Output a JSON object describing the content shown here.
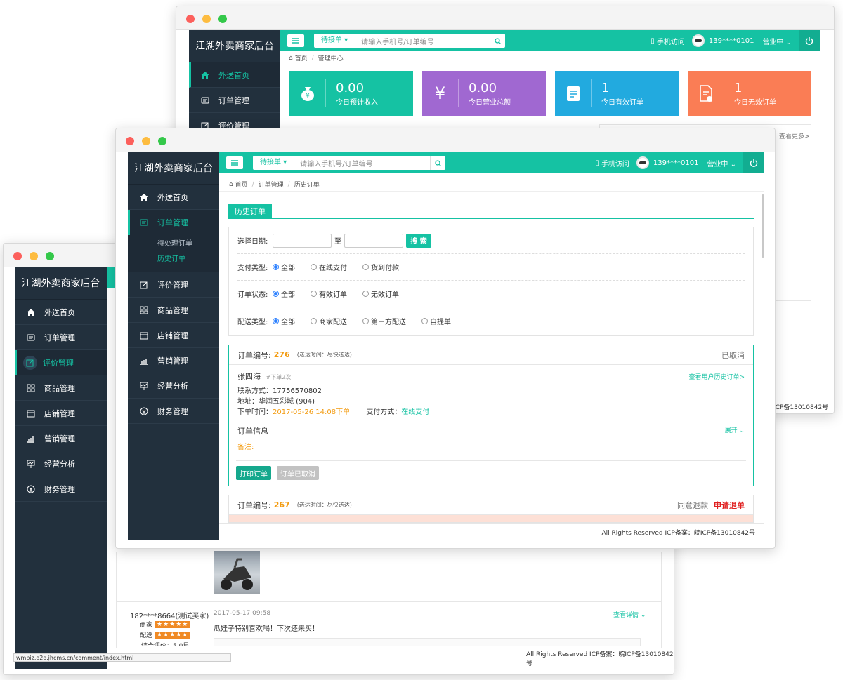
{
  "back": {
    "brand": "江湖外卖商家后台",
    "nav": [
      {
        "label": "外送首页",
        "icon": "home-icon",
        "active": true
      },
      {
        "label": "订单管理",
        "icon": "order-icon"
      },
      {
        "label": "评价管理",
        "icon": "edit-icon"
      }
    ],
    "search": {
      "select": "待接单",
      "placeholder": "请输入手机号/订单编号"
    },
    "mobile": "手机访问",
    "phone": "139****0101",
    "status": "营业中",
    "breadcrumb": [
      "首页",
      "管理中心"
    ],
    "cards": [
      {
        "value": "0.00",
        "label": "今日预计收入",
        "color": "#15c2a3",
        "icon": "money-bag-icon"
      },
      {
        "value": "0.00",
        "label": "今日营业总额",
        "color": "#a068d1",
        "icon": "yen-icon"
      },
      {
        "value": "1",
        "label": "今日有效订单",
        "color": "#22aadf",
        "icon": "clipboard-check-icon"
      },
      {
        "value": "1",
        "label": "今日无效订单",
        "color": "#fa7d55",
        "icon": "doc-minus-icon"
      }
    ],
    "see_more": "查看更多>",
    "footer": "ICP备13010842号"
  },
  "left": {
    "brand": "江湖外卖商家后台",
    "nav": [
      {
        "label": "外送首页",
        "icon": "home-icon"
      },
      {
        "label": "订单管理",
        "icon": "order-icon"
      },
      {
        "label": "评价管理",
        "icon": "edit-icon",
        "active": true
      },
      {
        "label": "商品管理",
        "icon": "grid-icon"
      },
      {
        "label": "店铺管理",
        "icon": "store-icon"
      },
      {
        "label": "营销管理",
        "icon": "chart-icon"
      },
      {
        "label": "经营分析",
        "icon": "monitor-icon"
      },
      {
        "label": "财务管理",
        "icon": "finance-icon"
      }
    ],
    "review": {
      "user": "182****8664(测试买家)",
      "time": "2017-05-17 09:58",
      "shop_label": "商家",
      "delivery_label": "配送",
      "overall": "综合评价：5.0星",
      "content": "瓜娃子特别喜欢喝！下次还来买！",
      "detail": "查看详情"
    },
    "url": "wmbiz.o2o.jhcms.cn/comment/index.html",
    "footer": "All Rights Reserved ICP备案：皖ICP备13010842号"
  },
  "front": {
    "brand": "江湖外卖商家后台",
    "nav": [
      {
        "label": "外送首页",
        "icon": "home-icon"
      },
      {
        "label": "订单管理",
        "icon": "order-icon",
        "active": true
      },
      {
        "label": "评价管理",
        "icon": "edit-icon"
      },
      {
        "label": "商品管理",
        "icon": "grid-icon"
      },
      {
        "label": "店铺管理",
        "icon": "store-icon"
      },
      {
        "label": "营销管理",
        "icon": "chart-icon"
      },
      {
        "label": "经营分析",
        "icon": "monitor-icon"
      },
      {
        "label": "财务管理",
        "icon": "finance-icon"
      }
    ],
    "subnav": [
      "待处理订单",
      "历史订单"
    ],
    "search": {
      "select": "待接单",
      "placeholder": "请输入手机号/订单编号"
    },
    "mobile": "手机访问",
    "phone": "139****0101",
    "status": "营业中",
    "breadcrumb": [
      "首页",
      "订单管理",
      "历史订单"
    ],
    "tab": "历史订单",
    "filter": {
      "date_label": "选择日期:",
      "to": "至",
      "search_btn": "搜 索",
      "pay_label": "支付类型:",
      "pay_opts": [
        "全部",
        "在线支付",
        "货到付款"
      ],
      "state_label": "订单状态:",
      "state_opts": [
        "全部",
        "有效订单",
        "无效订单"
      ],
      "ship_label": "配送类型:",
      "ship_opts": [
        "全部",
        "商家配送",
        "第三方配送",
        "自提单"
      ]
    },
    "order1": {
      "label": "订单编号:",
      "id": "276",
      "delivery": "(送达时间：尽快送达)",
      "status": "已取消",
      "name": "张四海",
      "times": "#下单2次",
      "history": "查看用户历史订单>",
      "contact": "联系方式：17756570802",
      "address": "地址：华润五彩城 (904)",
      "order_time_label": "下单时间：",
      "order_time": "2017-05-26 14:08下单",
      "pay_label": "支付方式：",
      "pay": "在线支付",
      "info_title": "订单信息",
      "expand": "展开",
      "remark": "备注:",
      "print_btn": "打印订单",
      "cancel_btn": "订单已取消"
    },
    "order2": {
      "label": "订单编号:",
      "id": "267",
      "delivery": "(送达时间：尽快送达)",
      "agree": "同意退款",
      "apply": "申请退单"
    },
    "footer": "All Rights Reserved ICP备案：皖ICP备13010842号"
  }
}
